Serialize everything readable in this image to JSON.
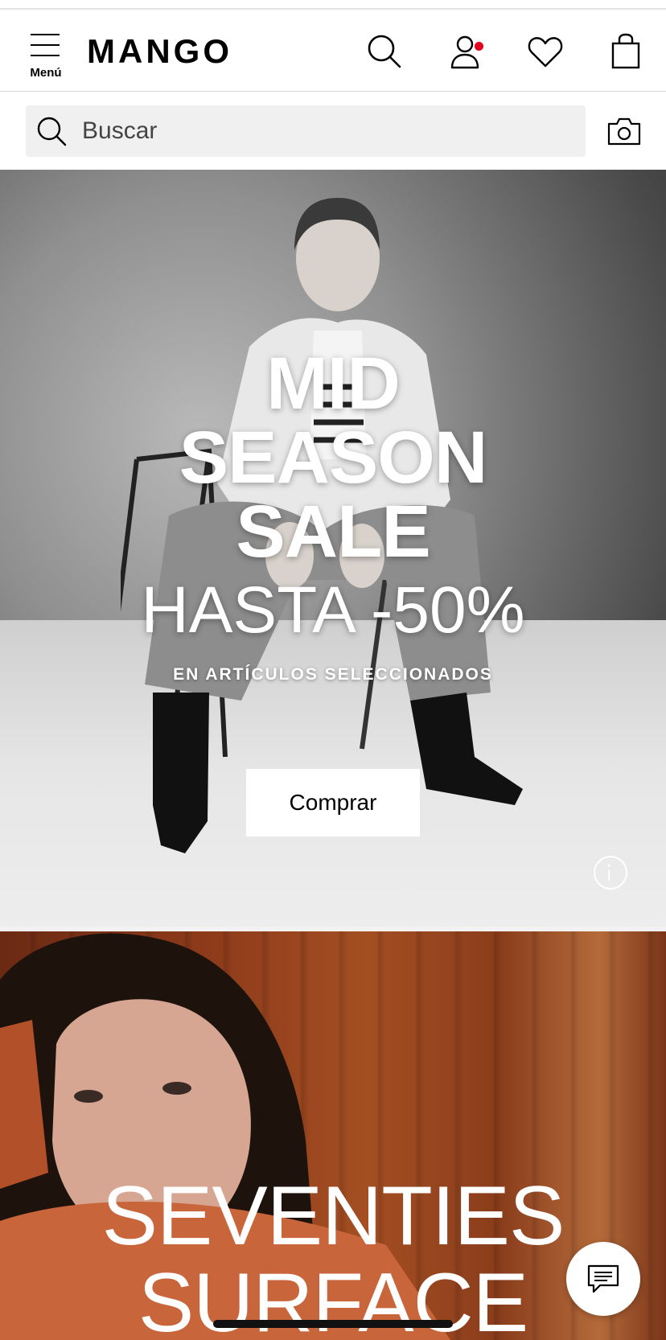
{
  "header": {
    "menu_label": "Menú",
    "logo": "MANGO",
    "icons": {
      "search": "search-icon",
      "account": "user-icon",
      "wishlist": "heart-icon",
      "bag": "shopping-bag-icon"
    },
    "account_notification": true
  },
  "search": {
    "placeholder": "Buscar",
    "camera_icon": "camera-icon"
  },
  "hero_sale": {
    "title_lines": [
      "MID",
      "SEASON",
      "SALE"
    ],
    "discount": "HASTA -50%",
    "subtitle": "EN ARTÍCULOS SELECCIONADOS",
    "cta_label": "Comprar",
    "info_icon": "info-icon"
  },
  "hero_collection": {
    "title_lines": [
      "SEVENTIES",
      "SURFACE"
    ]
  },
  "chat": {
    "icon": "chat-icon"
  },
  "colors": {
    "accent_notification": "#e3001b",
    "text": "#000000",
    "search_bg": "#f0f0f0"
  }
}
